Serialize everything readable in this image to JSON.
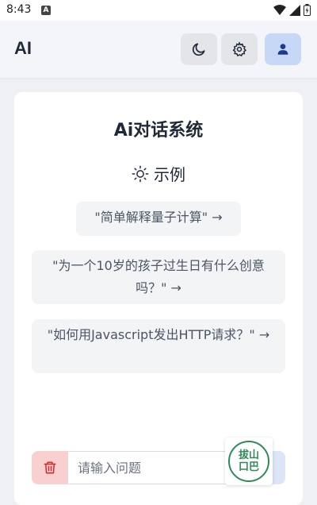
{
  "status_bar": {
    "time": "8:43",
    "notification_badge": "A"
  },
  "header": {
    "title": "AI",
    "theme_icon": "moon-icon",
    "settings_icon": "gear-icon",
    "user_icon": "user-icon"
  },
  "main": {
    "title": "Ai对话系统",
    "examples_label": "示例",
    "examples": [
      "\"简单解释量子计算\" →",
      "\"为一个10岁的孩子过生日有什么创意吗？\" →",
      "\"如何用Javascript发出HTTP请求？\" →"
    ]
  },
  "input": {
    "placeholder": "请输入问题",
    "value": ""
  },
  "watermark": {
    "line1": "拔山",
    "line2": "口巴"
  },
  "colors": {
    "accent": "#c7d7f6",
    "danger_bg": "#f9d0d0",
    "danger_icon": "#dc2626",
    "card_bg": "#ffffff",
    "page_bg": "#eef0f4"
  }
}
